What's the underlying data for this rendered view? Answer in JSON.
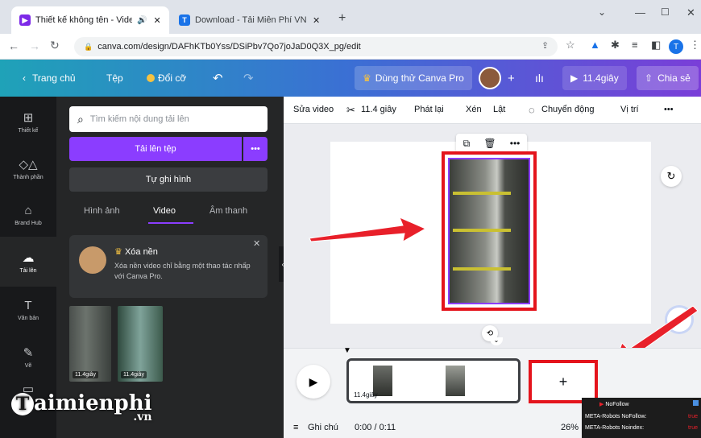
{
  "browser": {
    "tabs": [
      {
        "title": "Thiết kế không tên - Video",
        "favicon": "canva-video-icon"
      },
      {
        "title": "Download - Tải Miễn Phí VN - Ph",
        "favicon": "taimienphi-icon"
      }
    ],
    "url": "canva.com/design/DAFhKTb0Yss/DSiPbv7Qo7joJaD0Q3X_pg/edit",
    "profile_initial": "T"
  },
  "header": {
    "home": "Trang chủ",
    "file": "Tệp",
    "changes": "Đổi cỡ",
    "try_pro": "Dùng thử Canva Pro",
    "duration": "11.4giây",
    "share": "Chia sẻ"
  },
  "rail": [
    {
      "label": "Thiết kế",
      "icon": "layout-icon"
    },
    {
      "label": "Thành phần",
      "icon": "elements-icon"
    },
    {
      "label": "Brand Hub",
      "icon": "brand-icon"
    },
    {
      "label": "Tải lên",
      "icon": "upload-icon"
    },
    {
      "label": "Văn bản",
      "icon": "text-icon"
    },
    {
      "label": "Vẽ",
      "icon": "draw-icon"
    },
    {
      "label": "",
      "icon": "folder-icon"
    }
  ],
  "panel": {
    "search_placeholder": "Tìm kiếm nội dung tải lên",
    "upload_button": "Tải lên tệp",
    "more": "•••",
    "record_button": "Tự ghi hình",
    "tabs": [
      "Hình ảnh",
      "Video",
      "Âm thanh"
    ],
    "active_tab": "Video",
    "promo": {
      "title": "Xóa nền",
      "body": "Xóa nền video chỉ bằng một thao tác nhấp với Canva Pro."
    },
    "thumbs": [
      {
        "duration": "11.4giây"
      },
      {
        "duration": "11.4giây"
      }
    ]
  },
  "toolbar": {
    "edit_video": "Sửa video",
    "clip_duration": "11.4 giây",
    "playback": "Phát lại",
    "crop": "Xén",
    "flip": "Lật",
    "animate": "Chuyển động",
    "position": "Vị trí",
    "more": "•••"
  },
  "timeline": {
    "clip_label": "11.4giây",
    "notes": "Ghi chú",
    "time": "0:00 / 0:11",
    "zoom": "26%",
    "add_symbol": "+"
  },
  "overlay": {
    "nofollow": "NoFollow",
    "rows": [
      {
        "key": "META-Robots NoFollow:",
        "val": "true"
      },
      {
        "key": "META-Robots Noindex:",
        "val": "true"
      }
    ]
  },
  "watermark": {
    "text": "aimienphi",
    "suffix": ".vn"
  },
  "colors": {
    "purple": "#8b3dff",
    "arrow": "#e8202a",
    "highlight": "#e4141c"
  }
}
